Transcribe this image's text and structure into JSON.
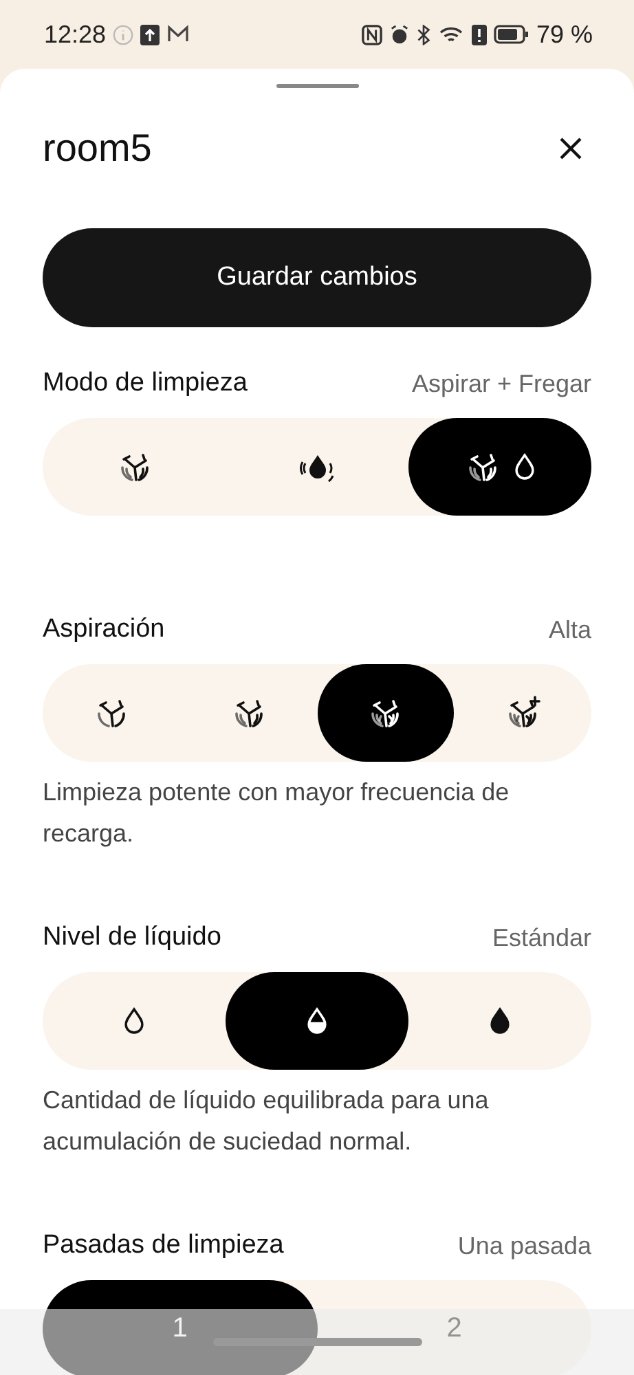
{
  "status_bar": {
    "time": "12:28",
    "battery": "79 %"
  },
  "sheet": {
    "title": "room5",
    "save_button": "Guardar cambios"
  },
  "sections": [
    {
      "title": "Modo de limpieza",
      "value": "Aspirar + Fregar",
      "options": [
        {
          "kind": "fan",
          "selected": false
        },
        {
          "kind": "mop",
          "selected": false
        },
        {
          "kind": "fandrop",
          "selected": true
        }
      ]
    },
    {
      "title": "Aspiración",
      "value": "Alta",
      "description": "Limpieza potente con mayor frecuencia de recarga.",
      "options": [
        {
          "kind": "fan1",
          "selected": false
        },
        {
          "kind": "fan",
          "selected": false
        },
        {
          "kind": "fan3",
          "selected": true
        },
        {
          "kind": "fanplus",
          "selected": false
        }
      ]
    },
    {
      "title": "Nivel de líquido",
      "value": "Estándar",
      "description": "Cantidad de líquido equilibrada para una acumulación de suciedad normal.",
      "options": [
        {
          "kind": "dropempty",
          "selected": false
        },
        {
          "kind": "drophalf",
          "selected": true
        },
        {
          "kind": "dropfull",
          "selected": false
        }
      ]
    },
    {
      "title": "Pasadas de limpieza",
      "value": "Una pasada",
      "options": [
        {
          "kind": "text",
          "label": "1",
          "selected": true
        },
        {
          "kind": "text",
          "label": "2",
          "selected": false
        }
      ]
    }
  ]
}
